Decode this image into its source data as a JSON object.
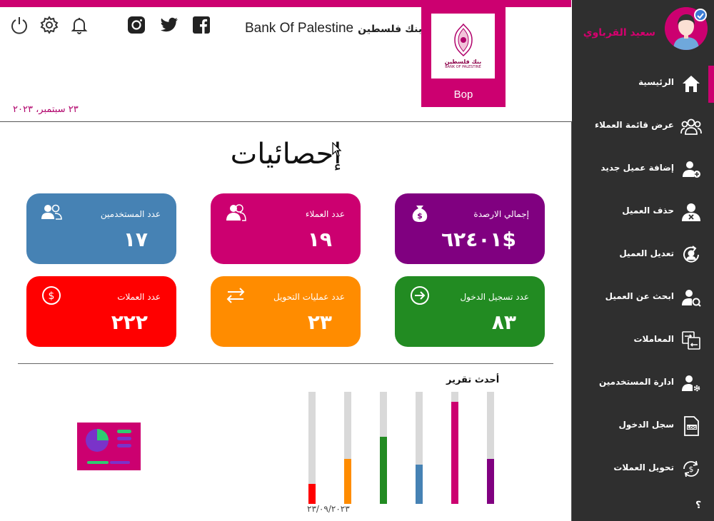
{
  "header": {
    "bank_name_en": "Bank Of Palestine",
    "bank_name_ar": "بنك فلسطين",
    "date": "٢٣ سبتمبر، ٢٠٢٣",
    "icons": [
      "power-icon",
      "settings-icon",
      "bell-icon",
      "instagram-icon",
      "twitter-icon",
      "facebook-icon"
    ]
  },
  "logo": {
    "text_ar": "بنك فلسطين",
    "text_en": "BANK OF PALESTINE",
    "caption": "Bop"
  },
  "main": {
    "title": "إحصائيات",
    "cards": [
      {
        "id": "balance",
        "label": "إجمالي الارصدة",
        "value": "٦٢٤٠١$",
        "color": "#800080",
        "icon": "money-bag-icon"
      },
      {
        "id": "customers",
        "label": "عدد العملاء",
        "value": "١٩",
        "color": "#cc0070",
        "icon": "customers-icon"
      },
      {
        "id": "users",
        "label": "عدد المستخدمين",
        "value": "١٧",
        "color": "#4682b4",
        "icon": "users-icon"
      },
      {
        "id": "logins",
        "label": "عدد تسجيل الدخول",
        "value": "٨٣",
        "color": "#228b22",
        "icon": "login-icon"
      },
      {
        "id": "transfers",
        "label": "عدد عمليات التحويل",
        "value": "٢٣",
        "color": "#ff8c00",
        "icon": "transfer-icon"
      },
      {
        "id": "currencies",
        "label": "عدد العملات",
        "value": "٢٢٢",
        "color": "#ff0000",
        "icon": "dollar-icon"
      }
    ]
  },
  "chart_data": {
    "type": "bar",
    "title": "أحدث تقرير",
    "xlabel": "٢٣/٠٩/٢٠٢٣",
    "series": [
      {
        "values": [
          0.18,
          0.4,
          0.6,
          0.35,
          0.91,
          0.4
        ]
      }
    ],
    "colors": [
      "#ff0000",
      "#ff8c00",
      "#228b22",
      "#4682b4",
      "#cc0070",
      "#800080"
    ],
    "ylim": [
      0,
      1
    ]
  },
  "sidebar": {
    "user_name": "سعيد القرباوي",
    "items": [
      {
        "label": "الرئيسية",
        "icon": "home-icon"
      },
      {
        "label": "عرض قائمة العملاء",
        "icon": "customers-list-icon"
      },
      {
        "label": "إضافة عميل جديد",
        "icon": "add-user-icon"
      },
      {
        "label": "حذف العميل",
        "icon": "delete-user-icon"
      },
      {
        "label": "تعديل العميل",
        "icon": "edit-user-icon"
      },
      {
        "label": "ابحث عن العميل",
        "icon": "search-user-icon"
      },
      {
        "label": "المعاملات",
        "icon": "transactions-icon"
      },
      {
        "label": "ادارة المستخدمين",
        "icon": "user-settings-icon"
      },
      {
        "label": "سجل الدخول",
        "icon": "log-icon"
      },
      {
        "label": "تحويل العملات",
        "icon": "currency-exchange-icon"
      }
    ],
    "help": "؟"
  }
}
